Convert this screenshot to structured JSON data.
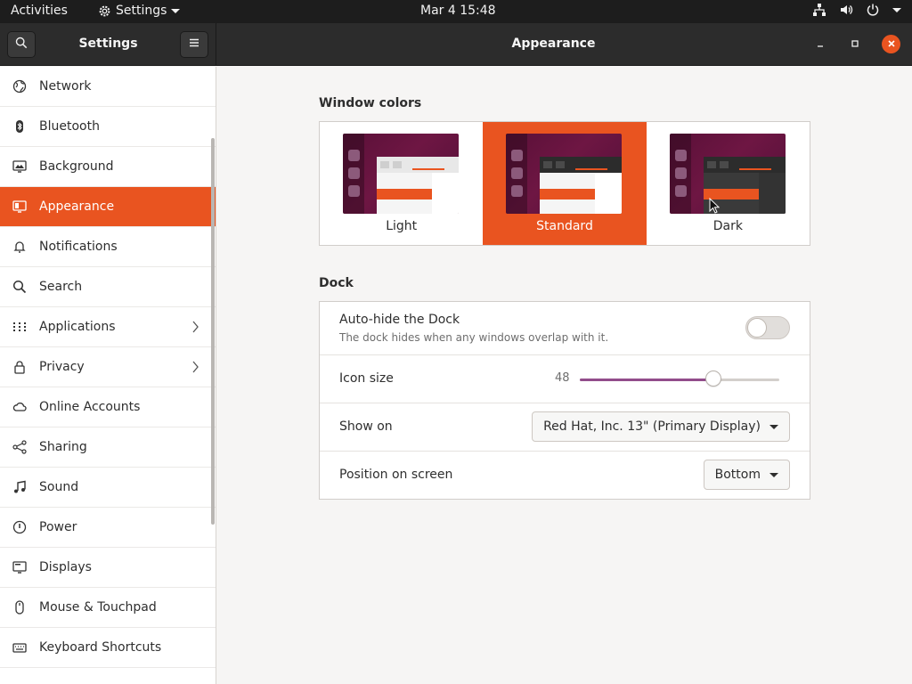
{
  "topbar": {
    "activities": "Activities",
    "app_menu": "Settings",
    "clock": "Mar 4  15:48",
    "icons": [
      "network-icon",
      "volume-icon",
      "power-icon"
    ]
  },
  "headerbar": {
    "sidebar_title": "Settings",
    "page_title": "Appearance"
  },
  "sidebar": {
    "items": [
      {
        "label": "Network",
        "icon": "globe-icon"
      },
      {
        "label": "Bluetooth",
        "icon": "bluetooth-icon"
      },
      {
        "label": "Background",
        "icon": "monitor-icon"
      },
      {
        "label": "Appearance",
        "icon": "appearance-icon",
        "active": true
      },
      {
        "label": "Notifications",
        "icon": "bell-icon"
      },
      {
        "label": "Search",
        "icon": "search-icon"
      },
      {
        "label": "Applications",
        "icon": "grid-icon",
        "has_submenu": true
      },
      {
        "label": "Privacy",
        "icon": "lock-icon",
        "has_submenu": true
      },
      {
        "label": "Online Accounts",
        "icon": "cloud-icon"
      },
      {
        "label": "Sharing",
        "icon": "share-icon"
      },
      {
        "label": "Sound",
        "icon": "music-note-icon"
      },
      {
        "label": "Power",
        "icon": "power-icon"
      },
      {
        "label": "Displays",
        "icon": "display-icon"
      },
      {
        "label": "Mouse & Touchpad",
        "icon": "mouse-icon"
      },
      {
        "label": "Keyboard Shortcuts",
        "icon": "keyboard-icon"
      }
    ]
  },
  "window_colors": {
    "title": "Window colors",
    "options": [
      "Light",
      "Standard",
      "Dark"
    ],
    "selected": "Standard"
  },
  "dock": {
    "title": "Dock",
    "autohide": {
      "label": "Auto-hide the Dock",
      "sublabel": "The dock hides when any windows overlap with it.",
      "enabled": false
    },
    "icon_size": {
      "label": "Icon size",
      "value": "48",
      "fraction": 0.67
    },
    "show_on": {
      "label": "Show on",
      "value": "Red Hat, Inc. 13\" (Primary Display)"
    },
    "position": {
      "label": "Position on screen",
      "value": "Bottom"
    }
  },
  "colors": {
    "accent": "#e95420",
    "slider": "#924d8b",
    "topbar": "#1d1d1d",
    "headerbar": "#2c2c2c"
  }
}
